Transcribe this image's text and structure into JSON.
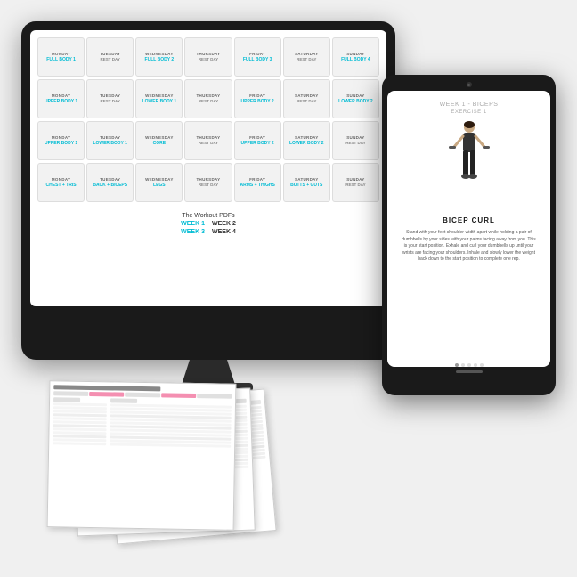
{
  "monitor": {
    "label": "Monitor"
  },
  "calendar": {
    "rows": [
      {
        "cells": [
          {
            "day": "MONDAY",
            "label": "FULL BODY 1",
            "type": "cyan"
          },
          {
            "day": "TUESDAY",
            "label": "REST DAY",
            "type": "rest"
          },
          {
            "day": "WEDNESDAY",
            "label": "FULL BODY 2",
            "type": "cyan"
          },
          {
            "day": "THURSDAY",
            "label": "REST DAY",
            "type": "rest"
          },
          {
            "day": "FRIDAY",
            "label": "FULL BODY 3",
            "type": "cyan"
          },
          {
            "day": "SATURDAY",
            "label": "REST DAY",
            "type": "rest"
          },
          {
            "day": "SUNDAY",
            "label": "FULL BODY 4",
            "type": "cyan"
          }
        ]
      },
      {
        "cells": [
          {
            "day": "MONDAY",
            "label": "UPPER BODY 1",
            "type": "cyan"
          },
          {
            "day": "TUESDAY",
            "label": "REST DAY",
            "type": "rest"
          },
          {
            "day": "WEDNESDAY",
            "label": "LOWER BODY 1",
            "type": "cyan"
          },
          {
            "day": "THURSDAY",
            "label": "REST DAY",
            "type": "rest"
          },
          {
            "day": "FRIDAY",
            "label": "UPPER BODY 2",
            "type": "cyan"
          },
          {
            "day": "SATURDAY",
            "label": "REST DAY",
            "type": "rest"
          },
          {
            "day": "SUNDAY",
            "label": "LOWER BODY 2",
            "type": "cyan"
          }
        ]
      },
      {
        "cells": [
          {
            "day": "MONDAY",
            "label": "UPPER BODY 1",
            "type": "cyan"
          },
          {
            "day": "TUESDAY",
            "label": "LOWER BODY 1",
            "type": "cyan"
          },
          {
            "day": "WEDNESDAY",
            "label": "CORE",
            "type": "cyan"
          },
          {
            "day": "THURSDAY",
            "label": "REST DAY",
            "type": "rest"
          },
          {
            "day": "FRIDAY",
            "label": "UPPER BODY 2",
            "type": "cyan"
          },
          {
            "day": "SATURDAY",
            "label": "LOWER BODY 2",
            "type": "cyan"
          },
          {
            "day": "SUNDAY",
            "label": "REST DAY",
            "type": "rest"
          }
        ]
      },
      {
        "cells": [
          {
            "day": "MONDAY",
            "label": "CHEST + TRIS",
            "type": "cyan"
          },
          {
            "day": "TUESDAY",
            "label": "BACK + BICEPS",
            "type": "cyan"
          },
          {
            "day": "WEDNESDAY",
            "label": "LEGS",
            "type": "cyan"
          },
          {
            "day": "THURSDAY",
            "label": "REST DAY",
            "type": "rest"
          },
          {
            "day": "FRIDAY",
            "label": "ARMS + THIGHS",
            "type": "cyan"
          },
          {
            "day": "SATURDAY",
            "label": "BUTTS + GUTS",
            "type": "cyan"
          },
          {
            "day": "SUNDAY",
            "label": "REST DAY",
            "type": "rest"
          }
        ]
      }
    ]
  },
  "pdf_section": {
    "title": "The Workout PDFs",
    "week1": "WEEK 1",
    "week2": "WEEK 2",
    "week3": "WEEK 3",
    "week4": "WEEK 4"
  },
  "tablet": {
    "week_label": "WEEK 1 - BICEPS",
    "exercise_number": "EXERCISE 1",
    "figure_alt": "woman with dumbbells",
    "exercise_name": "BICEP CURL",
    "description": "Stand with your feet shoulder-width apart while holding a pair of dumbbells by your sides with your palms facing away from you. This is your start position. Exhale and curl your dumbbells up until your wrists are facing your shoulders. Inhale and slowly lower the weight back down to the start position to complete one rep.",
    "dots_count": 5,
    "active_dot": 0
  }
}
